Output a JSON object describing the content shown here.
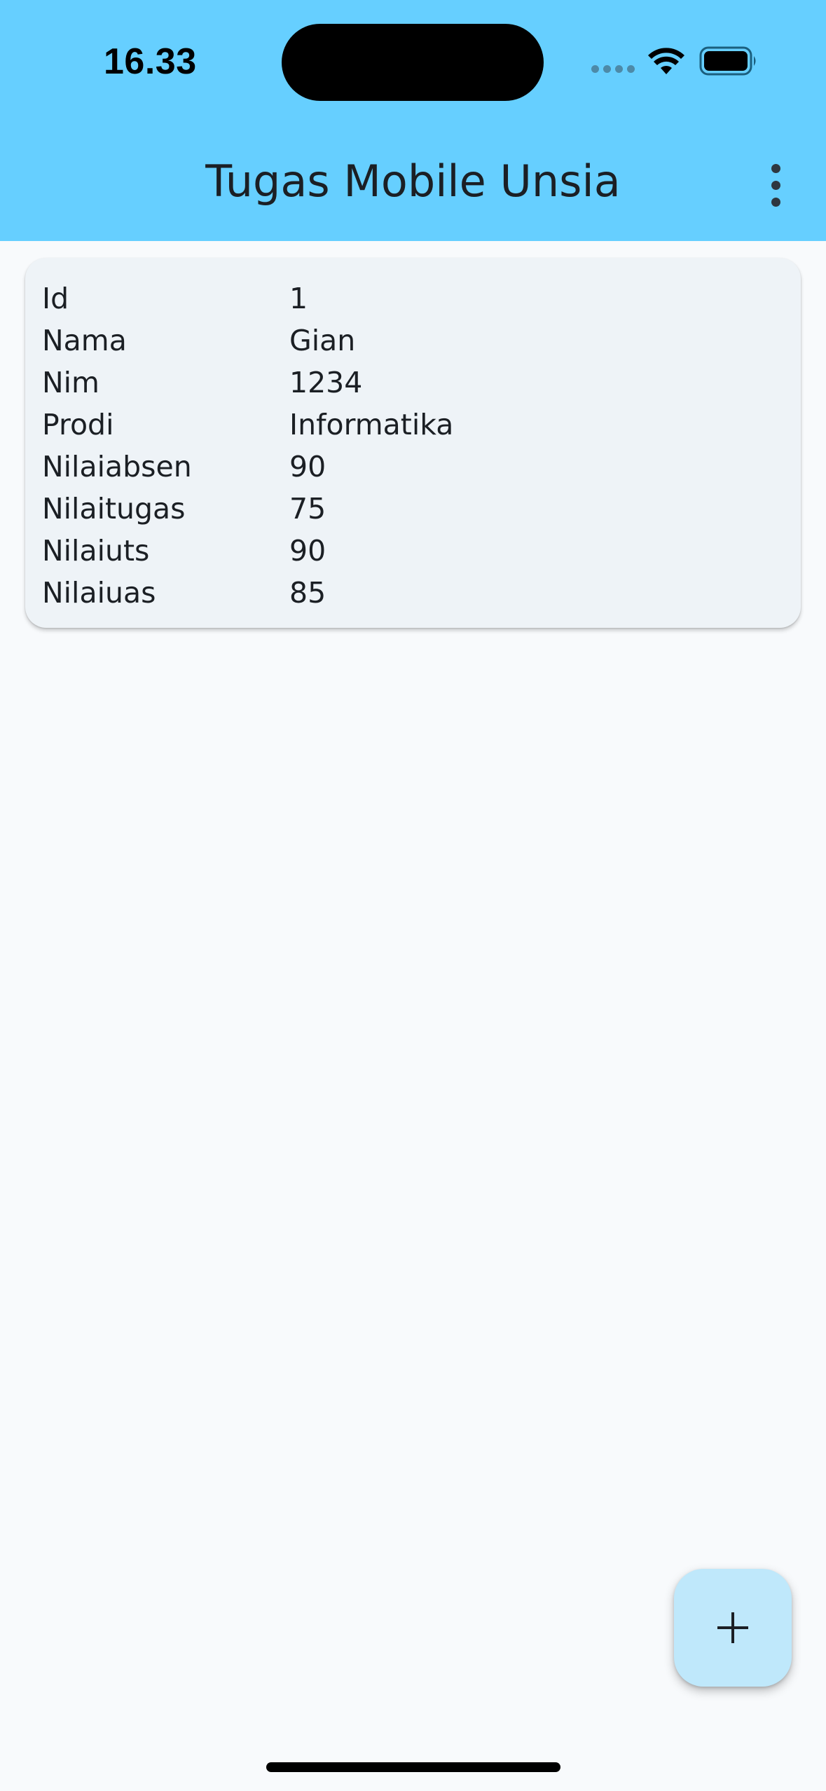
{
  "status_bar": {
    "time": "16.33",
    "icons": [
      "cellular-signal-icon",
      "wifi-icon",
      "battery-icon"
    ]
  },
  "app_bar": {
    "title": "Tugas Mobile Unsia",
    "menu_icon": "more-vert-icon",
    "background_color": "#66cfff"
  },
  "record": {
    "fields": [
      {
        "label": "Id",
        "value": "1"
      },
      {
        "label": "Nama",
        "value": "Gian"
      },
      {
        "label": "Nim",
        "value": "1234"
      },
      {
        "label": "Prodi",
        "value": "Informatika"
      },
      {
        "label": "Nilaiabsen",
        "value": "90"
      },
      {
        "label": "Nilaitugas",
        "value": "75"
      },
      {
        "label": "Nilaiuts",
        "value": "90"
      },
      {
        "label": "Nilaiuas",
        "value": "85"
      }
    ]
  },
  "fab": {
    "icon": "plus-icon",
    "color": "#bfe8fb"
  }
}
